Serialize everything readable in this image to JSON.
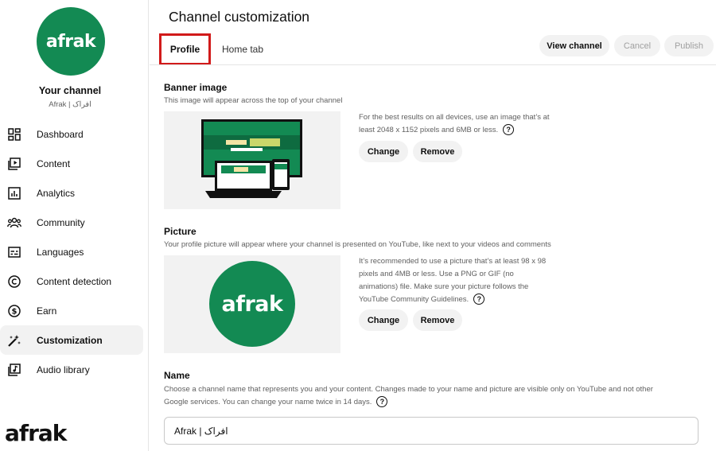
{
  "sidebar": {
    "avatar_logo": "afrak",
    "your_channel": "Your channel",
    "channel_handle": "Afrak | افراک",
    "items": [
      {
        "label": "Dashboard",
        "icon": "dashboard-icon"
      },
      {
        "label": "Content",
        "icon": "content-icon"
      },
      {
        "label": "Analytics",
        "icon": "analytics-icon"
      },
      {
        "label": "Community",
        "icon": "community-icon"
      },
      {
        "label": "Languages",
        "icon": "languages-icon"
      },
      {
        "label": "Content detection",
        "icon": "content-detection-icon"
      },
      {
        "label": "Earn",
        "icon": "earn-icon"
      },
      {
        "label": "Customization",
        "icon": "customization-icon",
        "active": true
      },
      {
        "label": "Audio library",
        "icon": "audio-library-icon"
      }
    ],
    "brand_logo": "afrak"
  },
  "header": {
    "title": "Channel customization",
    "tabs": [
      {
        "label": "Profile",
        "selected": true
      },
      {
        "label": "Home tab"
      }
    ],
    "view_channel": "View channel",
    "cancel": "Cancel",
    "publish": "Publish"
  },
  "banner": {
    "title": "Banner image",
    "description": "This image will appear across the top of your channel",
    "info_line1": "For the best results on all devices, use an image that’s at",
    "info_line2": "least 2048 x 1152 pixels and 6MB or less.",
    "change": "Change",
    "remove": "Remove"
  },
  "picture": {
    "title": "Picture",
    "description": "Your profile picture will appear where your channel is presented on YouTube, like next to your videos and comments",
    "logo": "afrak",
    "info_line1": "It’s recommended to use a picture that’s at least 98 x 98",
    "info_line2": "pixels and 4MB or less. Use a PNG or GIF (no",
    "info_line3": "animations) file. Make sure your picture follows the",
    "info_line4": "YouTube Community Guidelines.",
    "change": "Change",
    "remove": "Remove"
  },
  "name": {
    "title": "Name",
    "description_line1": "Choose a channel name that represents you and your content. Changes made to your name and picture are visible only on YouTube and not other",
    "description_line2": "Google services. You can change your name twice in 14 days.",
    "value": "Afrak | افراک"
  },
  "colors": {
    "brand_green": "#138a53",
    "highlight_red": "#d11a1a"
  }
}
